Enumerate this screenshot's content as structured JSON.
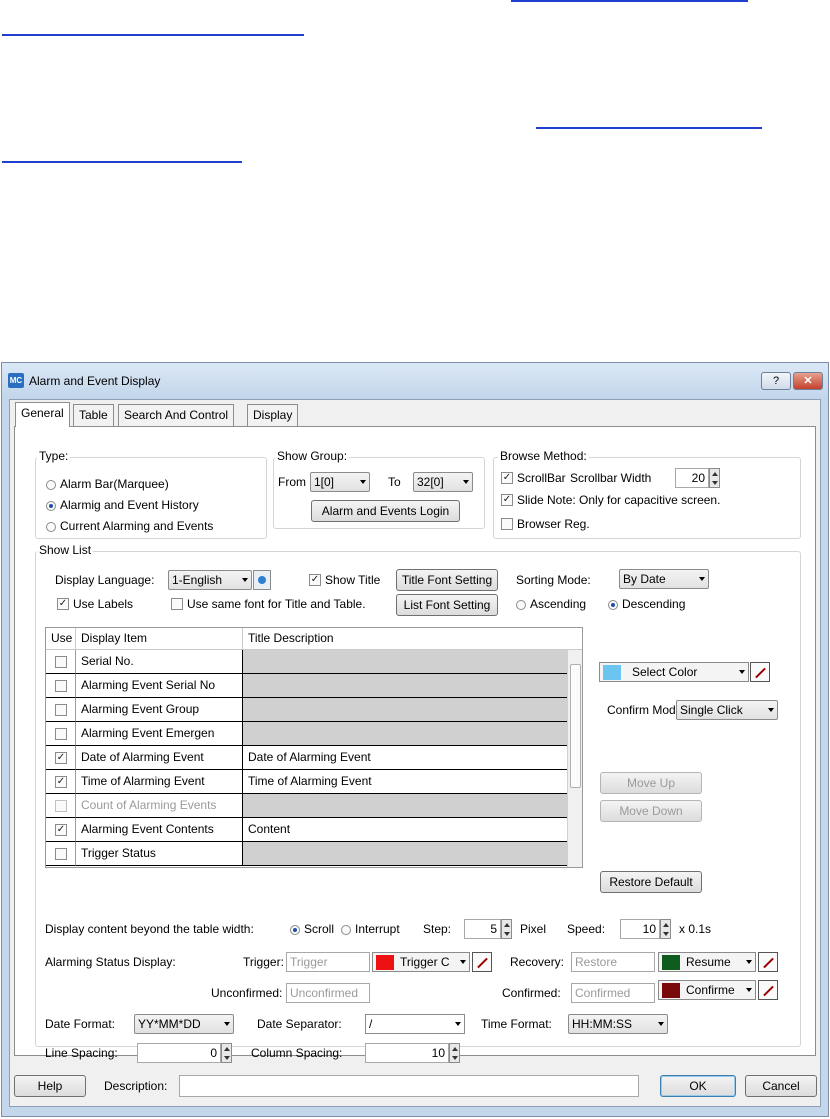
{
  "window": {
    "title": "Alarm and Event Display",
    "icon_text": "MC",
    "help_glyph": "?",
    "close_glyph": "✕"
  },
  "tabs": [
    "General",
    "Table",
    "Search And Control",
    "Display"
  ],
  "type_group": {
    "label": "Type:",
    "options": [
      "Alarm Bar(Marquee)",
      "Alarmig and Event History",
      "Current Alarming and Events"
    ],
    "selected": 1
  },
  "show_group": {
    "label": "Show Group:",
    "from_label": "From",
    "from_value": "1[0]",
    "to_label": "To",
    "to_value": "32[0]",
    "login_button": "Alarm and Events Login"
  },
  "browse_method": {
    "label": "Browse Method:",
    "scrollbar_label": "ScrollBar",
    "scrollbar_width_label": "Scrollbar Width",
    "scrollbar_width_value": "20",
    "slide_note_label": "Slide Note: Only for capacitive screen.",
    "browser_reg_label": "Browser Reg.",
    "scrollbar_checked": true,
    "slide_note_checked": true,
    "browser_reg_checked": false
  },
  "show_list": {
    "label": "Show List",
    "display_language_label": "Display Language:",
    "display_language_value": "1-English",
    "show_title_label": "Show Title",
    "title_font_button": "Title Font Setting",
    "sorting_mode_label": "Sorting Mode:",
    "sorting_mode_value": "By Date",
    "use_labels_label": "Use Labels",
    "same_font_label": "Use same font for Title and Table.",
    "list_font_button": "List Font Setting",
    "ascending_label": "Ascending",
    "descending_label": "Descending"
  },
  "table": {
    "headers": [
      "Use",
      "Display Item",
      "Title Description"
    ],
    "rows": [
      {
        "item": "Serial No.",
        "desc": "",
        "checked": false
      },
      {
        "item": "Alarming Event Serial No",
        "desc": "",
        "checked": false
      },
      {
        "item": "Alarming Event Group",
        "desc": "",
        "checked": false
      },
      {
        "item": "Alarming Event Emergen",
        "desc": "",
        "checked": false
      },
      {
        "item": "Date of Alarming Event",
        "desc": "Date of Alarming Event",
        "checked": true
      },
      {
        "item": "Time of Alarming Event",
        "desc": "Time of Alarming Event",
        "checked": true
      },
      {
        "item": "Count of Alarming Events",
        "desc": "",
        "checked": false
      },
      {
        "item": "Alarming Event Contents",
        "desc": "Content",
        "checked": true
      },
      {
        "item": "Trigger Status",
        "desc": "",
        "checked": false
      }
    ]
  },
  "right_panel": {
    "select_color_label": "Select Color",
    "select_color_hex": "#6cc4f0",
    "confirm_mode_label": "Confirm Mode:",
    "confirm_mode_value": "Single Click",
    "move_up": "Move Up",
    "move_down": "Move Down",
    "restore_default": "Restore Default"
  },
  "display_beyond": {
    "label": "Display content beyond the table width:",
    "scroll_label": "Scroll",
    "interrupt_label": "Interrupt",
    "step_label": "Step:",
    "step_value": "5",
    "pixel_label": "Pixel",
    "speed_label": "Speed:",
    "speed_value": "10",
    "speed_unit": "x 0.1s"
  },
  "alarm_status": {
    "label": "Alarming Status Display:",
    "trigger_label": "Trigger:",
    "trigger_value": "Trigger",
    "trigger_color_label": "Trigger C",
    "trigger_color_hex": "#ee1111",
    "recovery_label": "Recovery:",
    "recovery_value": "Restore",
    "resume_color_label": "Resume",
    "resume_color_hex": "#0e5c1e",
    "unconfirmed_label": "Unconfirmed:",
    "unconfirmed_value": "Unconfirmed",
    "confirmed_label": "Confirmed:",
    "confirmed_value": "Confirmed",
    "confirm_color_label": "Confirme",
    "confirm_color_hex": "#7a0a0a"
  },
  "formats": {
    "date_format_label": "Date Format:",
    "date_format_value": "YY*MM*DD",
    "date_separator_label": "Date Separator:",
    "date_separator_value": "/",
    "time_format_label": "Time Format:",
    "time_format_value": "HH:MM:SS",
    "line_spacing_label": "Line Spacing:",
    "line_spacing_value": "0",
    "column_spacing_label": "Column Spacing:",
    "column_spacing_value": "10"
  },
  "footer": {
    "help": "Help",
    "description_label": "Description:",
    "description_value": "",
    "ok": "OK",
    "cancel": "Cancel"
  }
}
